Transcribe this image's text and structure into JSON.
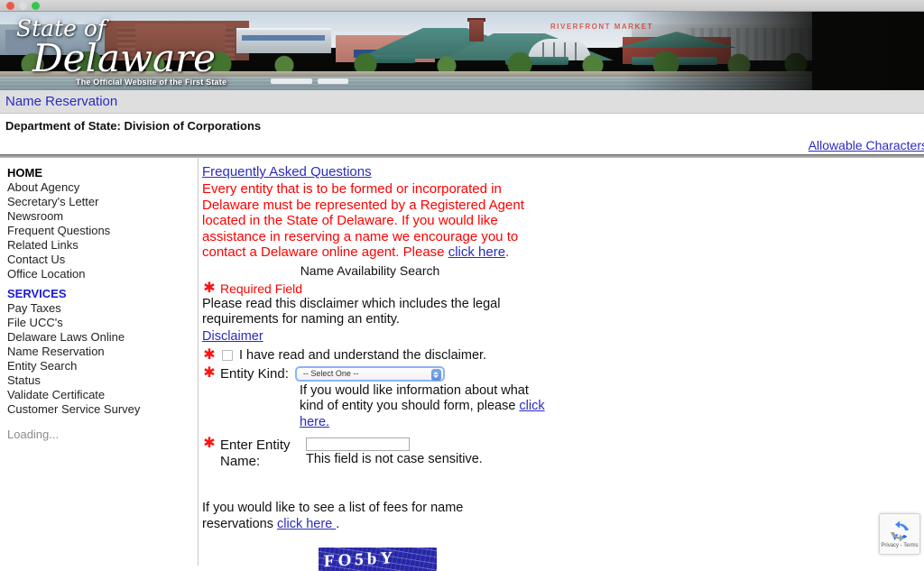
{
  "window": {
    "controls": [
      "close",
      "minimize",
      "maximize"
    ]
  },
  "banner": {
    "logo_line1": "State of",
    "logo_line2": "Delaware",
    "tagline": "The Official Website of the First State",
    "market_sign": "RIVERFRONT MARKET"
  },
  "header": {
    "page_title": "Name Reservation",
    "subtitle": "Department of State: Division of Corporations",
    "allowable_characters_link": "Allowable Characters"
  },
  "sidebar": {
    "groups": [
      {
        "heading": "HOME",
        "items": [
          "About Agency",
          "Secretary's Letter",
          "Newsroom",
          "Frequent Questions",
          "Related Links",
          "Contact Us",
          "Office Location"
        ]
      },
      {
        "heading": "SERVICES",
        "items": [
          "Pay Taxes",
          "File UCC's",
          "Delaware Laws Online",
          "Name Reservation",
          "Entity Search",
          "Status",
          "Validate Certificate",
          "Customer Service Survey"
        ]
      }
    ],
    "loading_text": "Loading..."
  },
  "main": {
    "faq_link": "Frequently Asked Questions",
    "notice": {
      "text_before_link": "Every entity that is to be formed or incorporated in Delaware must be represented by a Registered Agent located in the State of Delaware. If you would like assistance in reserving a name we encourage you to contact a Delaware online agent. Please ",
      "link_text": "click here",
      "text_after_link": "."
    },
    "availability_heading": "Name Availability Search",
    "required_field_label": "Required Field",
    "required_star": "✱",
    "disclaimer_paragraph": "Please read this disclaimer which includes the legal requirements for naming an entity.",
    "disclaimer_link": "Disclaimer",
    "disclaimer_checkbox": {
      "label": "I have read and understand the disclaimer.",
      "checked": false
    },
    "entity_kind": {
      "label": "Entity Kind:",
      "selected_value": "-- Select One --",
      "help_text_before_link": "If you would like information about what kind of entity you should form, please ",
      "help_link_text": "click here.",
      "help_text_after_link": ""
    },
    "entity_name": {
      "label": "Enter Entity Name:",
      "label_line1": "Enter Entity",
      "label_line2": "Name:",
      "value": "",
      "note": "This field is not case sensitive."
    },
    "fees": {
      "text_before_link": "If you would like to see a list of fees for name reservations ",
      "link_text": "click here ",
      "text_after_link": "."
    },
    "captcha_text": "FO5bY"
  },
  "recaptcha": {
    "terms_text": "Privacy - Terms",
    "icon": "recaptcha-logo-icon"
  },
  "colors": {
    "link_blue": "#2b2bc0",
    "notice_red": "#ff0000",
    "services_blue": "#1b1bd6",
    "title_band": "#dedede"
  }
}
